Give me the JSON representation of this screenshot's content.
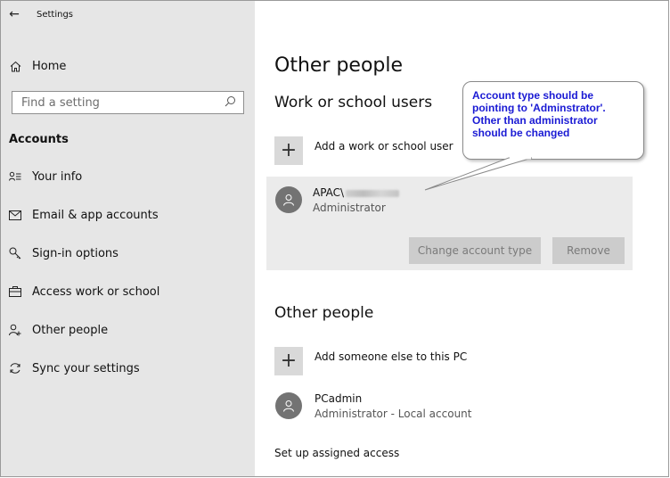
{
  "window": {
    "title": "Settings"
  },
  "sidebar": {
    "home_label": "Home",
    "search_placeholder": "Find a setting",
    "section_title": "Accounts",
    "items": [
      {
        "label": "Your info",
        "icon": "person-list-icon"
      },
      {
        "label": "Email & app accounts",
        "icon": "mail-icon"
      },
      {
        "label": "Sign-in options",
        "icon": "key-icon"
      },
      {
        "label": "Access work or school",
        "icon": "briefcase-icon"
      },
      {
        "label": "Other people",
        "icon": "person-add-icon"
      },
      {
        "label": "Sync your settings",
        "icon": "sync-icon"
      }
    ]
  },
  "main": {
    "page_title": "Other people",
    "work_section": {
      "title": "Work or school users",
      "add_label": "Add a work or school user",
      "account": {
        "name_prefix": "APAC\\",
        "role": "Administrator",
        "change_type_label": "Change account type",
        "remove_label": "Remove"
      }
    },
    "other_section": {
      "title": "Other people",
      "add_label": "Add someone else to this PC",
      "account": {
        "name": "PCadmin",
        "role": "Administrator - Local account"
      }
    },
    "assigned_access_link": "Set up assigned access"
  },
  "callout": {
    "lines": [
      "Account type should be",
      "pointing to 'Adminstrator'.",
      "Other than administrator",
      "should be changed"
    ],
    "text_color": "#1a1ad4"
  },
  "colors": {
    "sidebar_bg": "#e6e6e6",
    "card_bg": "#ebebeb",
    "button_bg": "#cccccc",
    "avatar_bg": "#737373"
  }
}
